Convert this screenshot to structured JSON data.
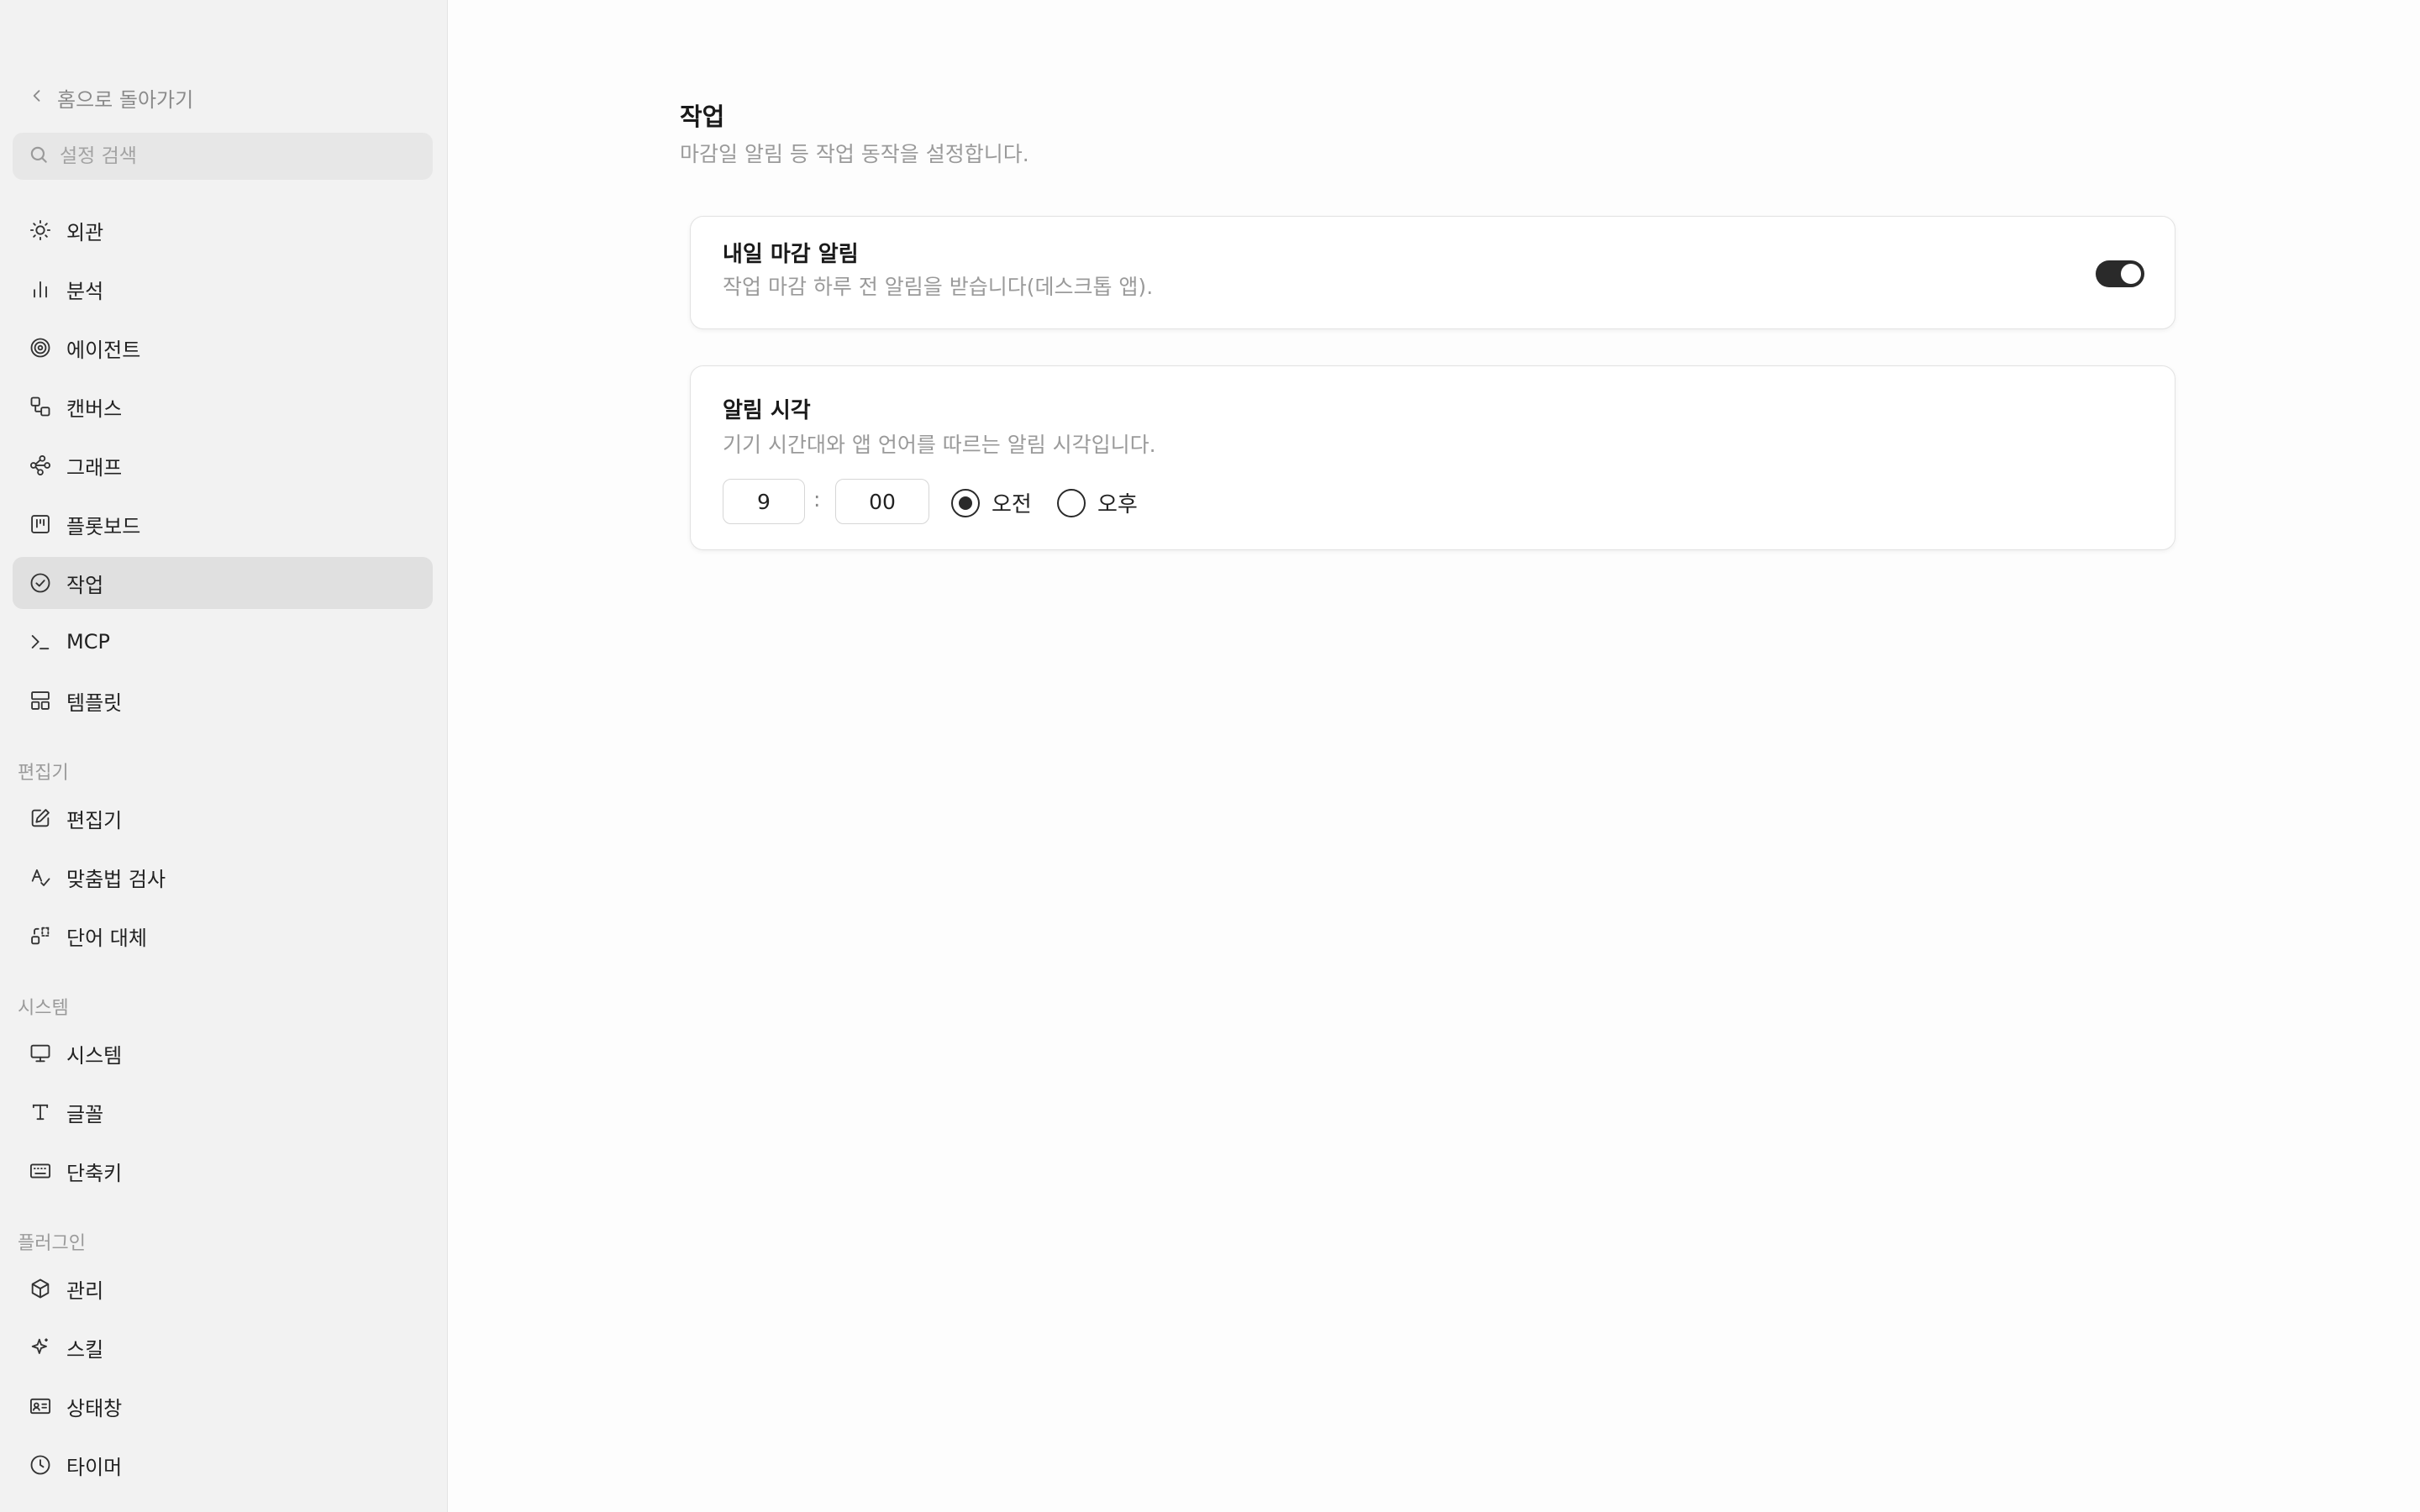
{
  "sidebar": {
    "back_label": "홈으로 돌아가기",
    "search_placeholder": "설정 검색",
    "items": [
      {
        "label": "외관",
        "icon": "sun-icon"
      },
      {
        "label": "분석",
        "icon": "bar-chart-icon"
      },
      {
        "label": "에이전트",
        "icon": "spiral-icon"
      },
      {
        "label": "캔버스",
        "icon": "canvas-shapes-icon"
      },
      {
        "label": "그래프",
        "icon": "graph-nodes-icon"
      },
      {
        "label": "플롯보드",
        "icon": "kanban-icon"
      },
      {
        "label": "작업",
        "icon": "check-circle-icon",
        "active": true
      },
      {
        "label": "MCP",
        "icon": "terminal-icon"
      },
      {
        "label": "템플릿",
        "icon": "layout-template-icon"
      }
    ],
    "sections": [
      {
        "label": "편집기",
        "items": [
          {
            "label": "편집기",
            "icon": "edit-icon"
          },
          {
            "label": "맞춤법 검사",
            "icon": "spell-check-icon"
          },
          {
            "label": "단어 대체",
            "icon": "replace-icon"
          }
        ]
      },
      {
        "label": "시스템",
        "items": [
          {
            "label": "시스템",
            "icon": "monitor-icon"
          },
          {
            "label": "글꼴",
            "icon": "type-icon"
          },
          {
            "label": "단축키",
            "icon": "keyboard-icon"
          }
        ]
      },
      {
        "label": "플러그인",
        "items": [
          {
            "label": "관리",
            "icon": "package-icon"
          },
          {
            "label": "스킬",
            "icon": "sparkle-icon"
          },
          {
            "label": "상태창",
            "icon": "id-card-icon"
          },
          {
            "label": "타이머",
            "icon": "clock-icon"
          }
        ]
      }
    ]
  },
  "main": {
    "title": "작업",
    "subtitle": "마감일 알림 등 작업 동작을 설정합니다.",
    "cards": [
      {
        "title": "내일 마감 알림",
        "description": "작업 마감 하루 전 알림을 받습니다(데스크톱 앱).",
        "toggle_on": true
      },
      {
        "title": "알림 시각",
        "description": "기기 시간대와 앱 언어를 따르는 알림 시각입니다.",
        "hour": "9",
        "separator": ":",
        "minute": "00",
        "am_label": "오전",
        "pm_label": "오후",
        "selected": "am"
      }
    ]
  },
  "colors": {
    "sidebar_bg": "#f2f2f2",
    "active_item_bg": "#e0e0e0",
    "toggle_on": "#2a2a2a",
    "muted_text": "#9a9a9a"
  }
}
